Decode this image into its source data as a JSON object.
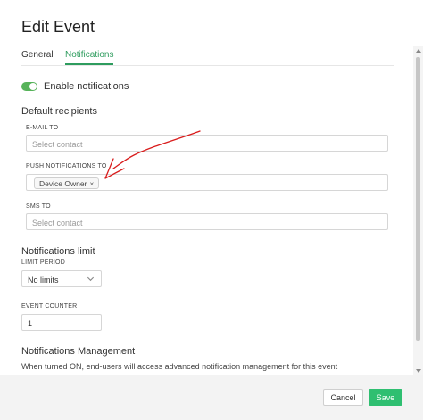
{
  "dialog": {
    "title": "Edit Event",
    "tabs": [
      {
        "label": "General"
      },
      {
        "label": "Notifications"
      }
    ]
  },
  "enable_notifications": {
    "label": "Enable notifications",
    "enabled": true
  },
  "default_recipients": {
    "heading": "Default recipients",
    "email": {
      "label": "E-MAIL TO",
      "placeholder": "Select contact"
    },
    "push": {
      "label": "PUSH NOTIFICATIONS TO",
      "chip_label": "Device Owner",
      "chip_remove": "×"
    },
    "sms": {
      "label": "SMS TO",
      "placeholder": "Select contact"
    }
  },
  "notifications_limit": {
    "heading": "Notifications limit",
    "limit_period_label": "LIMIT PERIOD",
    "limit_period_value": "No limits",
    "event_counter_label": "EVENT COUNTER",
    "event_counter_value": "1"
  },
  "notifications_management": {
    "heading": "Notifications Management",
    "description": "When turned ON, end-users will access advanced notification management for this event"
  },
  "footer": {
    "cancel_label": "Cancel",
    "save_label": "Save"
  },
  "colors": {
    "accent": "#2e9c5e",
    "save_button": "#2fbf71",
    "toggle_on": "#57b35a",
    "annotation_arrow": "#d91c1c"
  },
  "icons": {
    "limit_period_dropdown": "chevron-down-icon",
    "annotation": "red-arrow-annotation"
  }
}
